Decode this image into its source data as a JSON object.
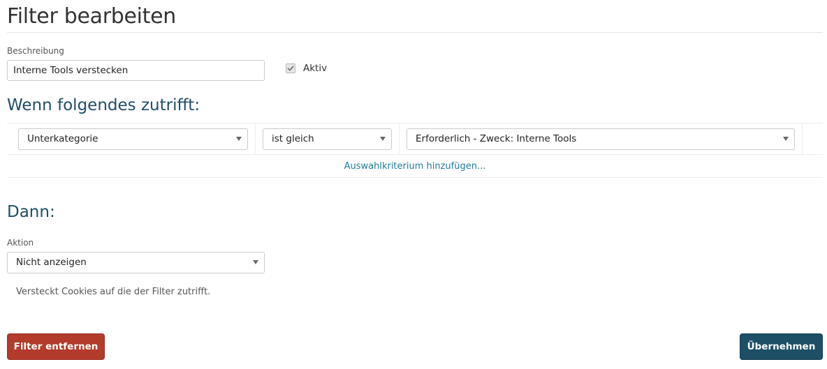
{
  "page": {
    "title": "Filter bearbeiten"
  },
  "description": {
    "label": "Beschreibung",
    "value": "Interne Tools verstecken"
  },
  "active": {
    "label": "Aktiv",
    "checked": true
  },
  "conditions": {
    "heading": "Wenn folgendes zutrifft:",
    "rows": [
      {
        "field": "Unterkategorie",
        "operator": "ist gleich",
        "value": "Erforderlich - Zweck: Interne Tools"
      }
    ],
    "add_link": "Auswahlkriterium hinzufügen..."
  },
  "then": {
    "heading": "Dann:",
    "action_label": "Aktion",
    "action_value": "Nicht anzeigen",
    "help_text": "Versteckt Cookies auf die der Filter zutrifft."
  },
  "buttons": {
    "remove": "Filter entfernen",
    "apply": "Übernehmen"
  },
  "colors": {
    "heading": "#1f4e66",
    "link": "#1f7d9a",
    "danger": "#b23b2b",
    "primary": "#1d4f66"
  },
  "icons": {
    "checkbox": "checkmark-icon",
    "select": "caret-down-icon"
  }
}
